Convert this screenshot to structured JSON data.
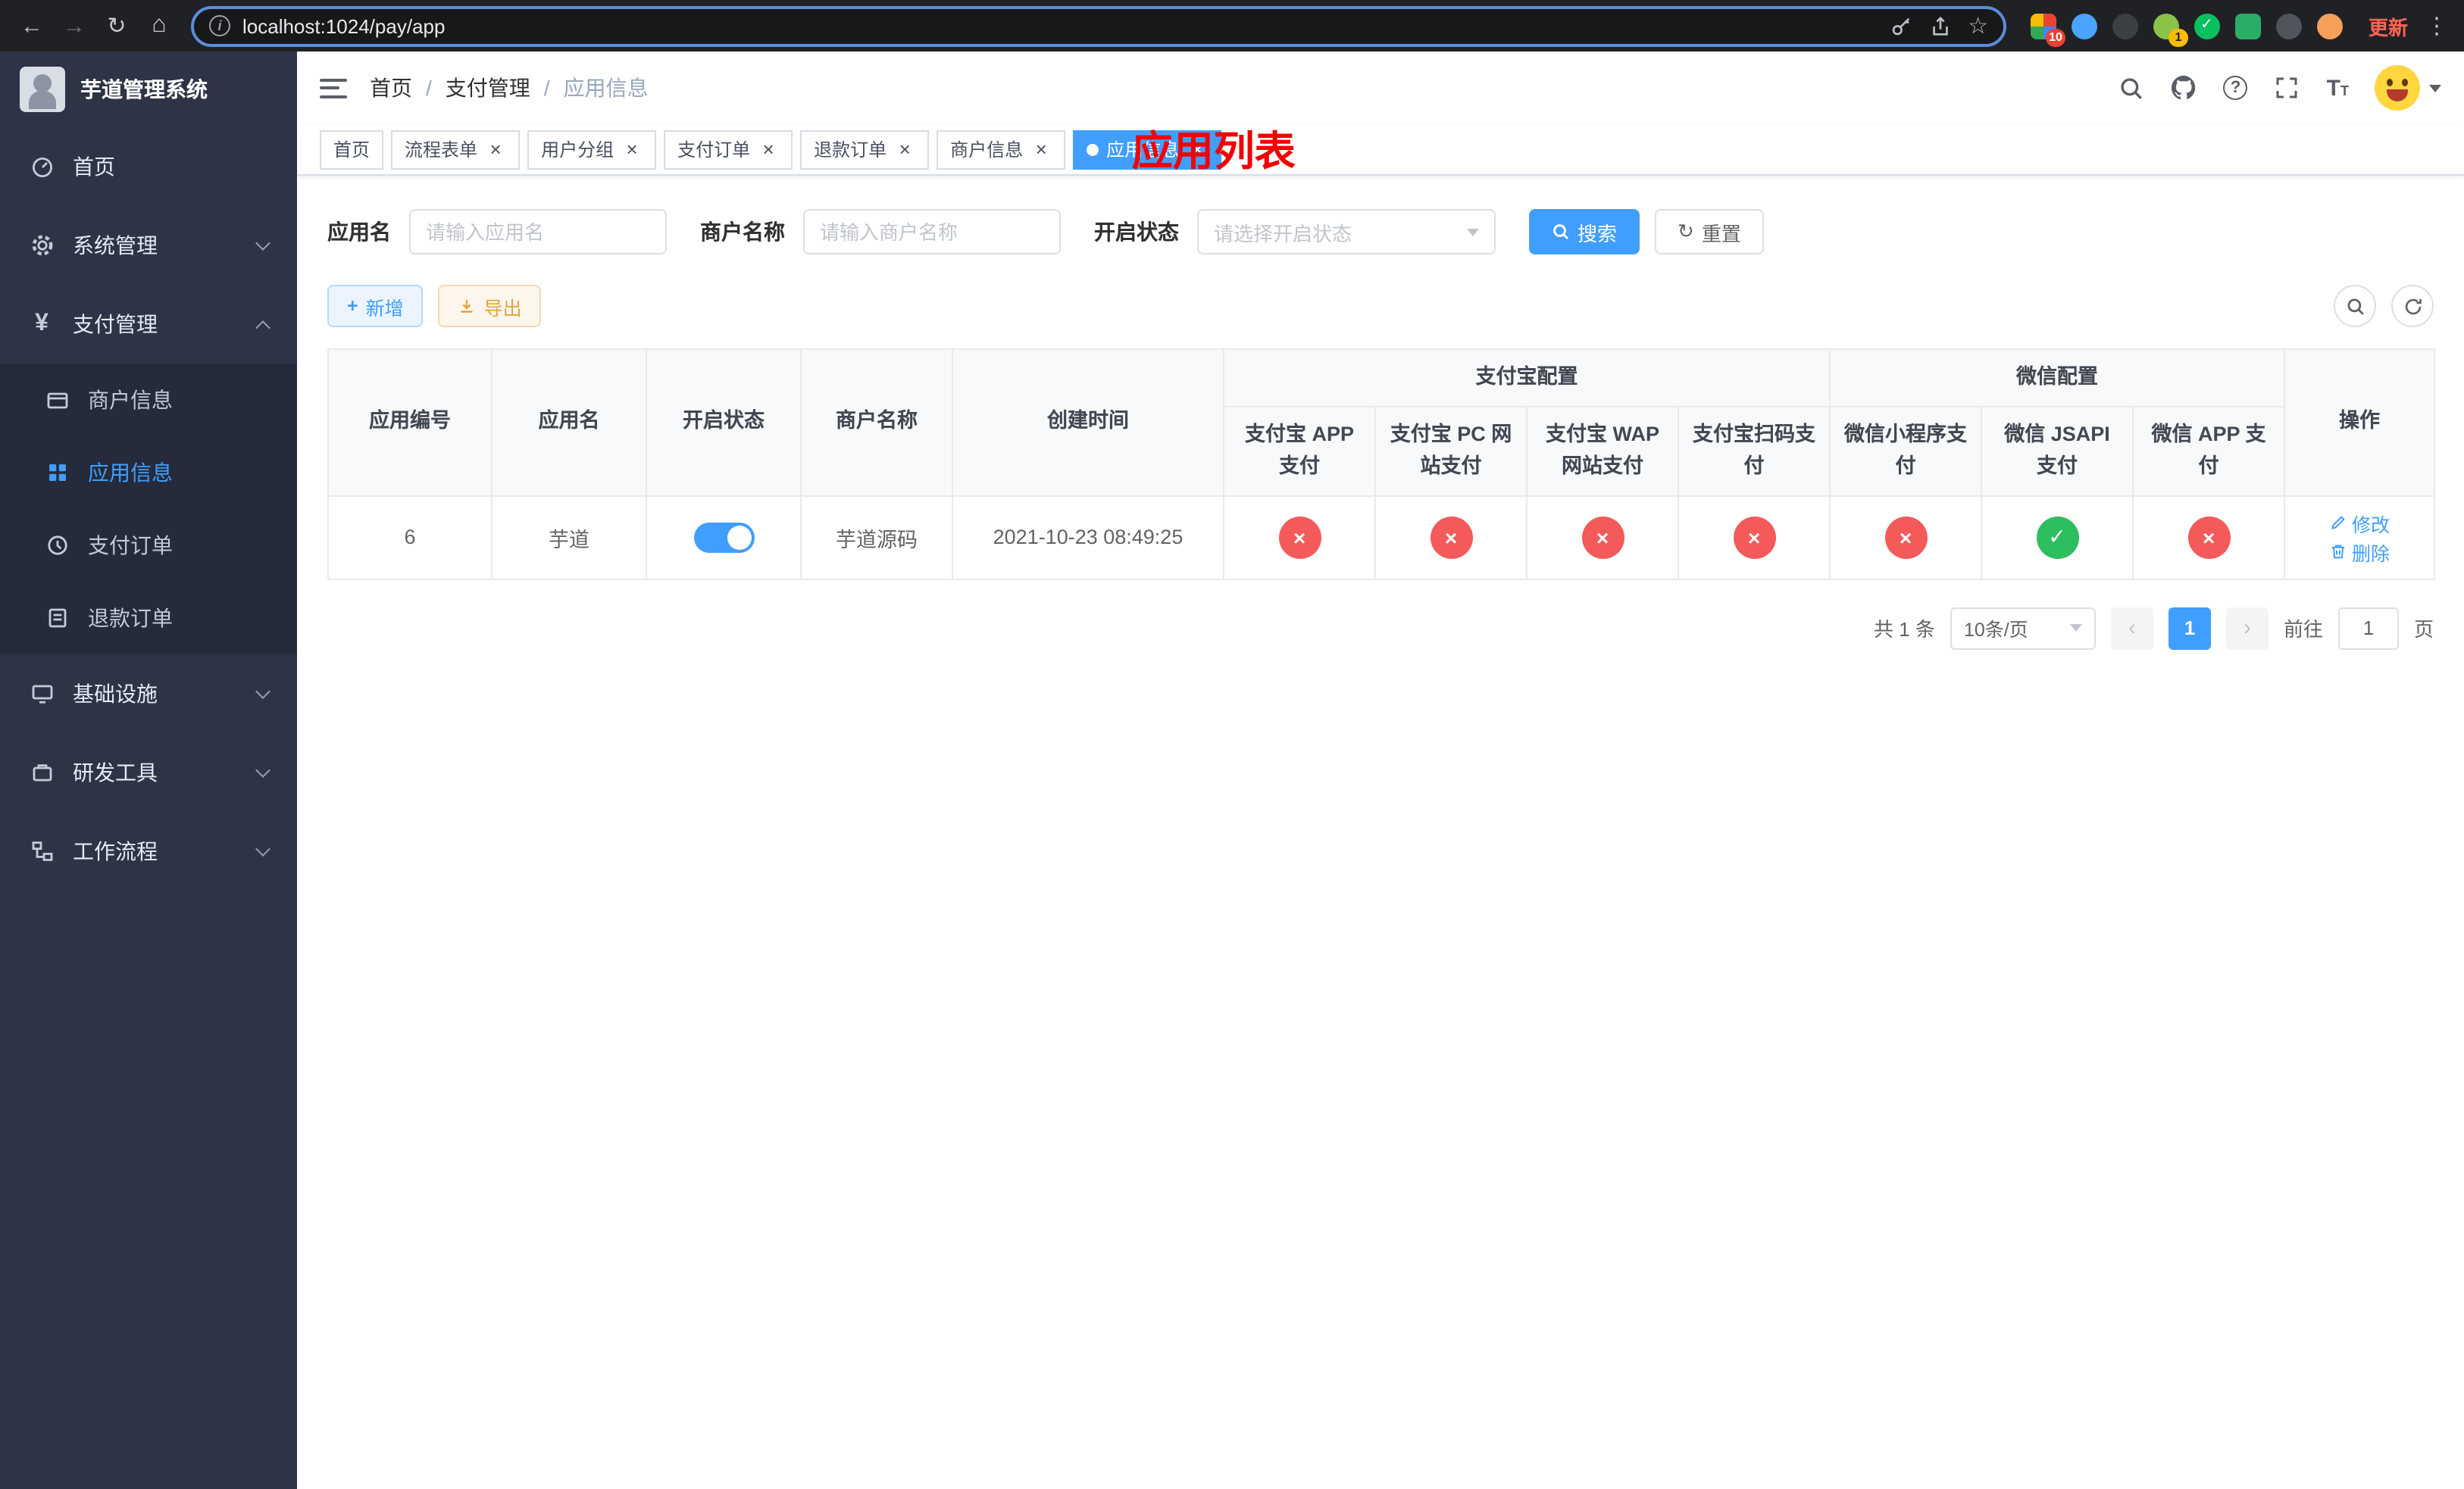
{
  "browser": {
    "url": "localhost:1024/pay/app",
    "update_label": "更新",
    "ext_badge_1": "10",
    "ext_badge_2": "1"
  },
  "sidebar": {
    "title": "芋道管理系统",
    "menu": [
      {
        "label": "首页"
      },
      {
        "label": "系统管理"
      },
      {
        "label": "支付管理",
        "children": [
          {
            "label": "商户信息"
          },
          {
            "label": "应用信息"
          },
          {
            "label": "支付订单"
          },
          {
            "label": "退款订单"
          }
        ]
      },
      {
        "label": "基础设施"
      },
      {
        "label": "研发工具"
      },
      {
        "label": "工作流程"
      }
    ]
  },
  "header": {
    "breadcrumb": [
      {
        "label": "首页"
      },
      {
        "label": "支付管理"
      },
      {
        "label": "应用信息"
      }
    ],
    "page_title": "应用列表"
  },
  "tabs": [
    {
      "label": "首页",
      "active": "false"
    },
    {
      "label": "流程表单",
      "active": "false"
    },
    {
      "label": "用户分组",
      "active": "false"
    },
    {
      "label": "支付订单",
      "active": "false"
    },
    {
      "label": "退款订单",
      "active": "false"
    },
    {
      "label": "商户信息",
      "active": "false"
    },
    {
      "label": "应用信息",
      "active": "true"
    }
  ],
  "filters": {
    "app_name_label": "应用名",
    "app_name_placeholder": "请输入应用名",
    "merchant_label": "商户名称",
    "merchant_placeholder": "请输入商户名称",
    "status_label": "开启状态",
    "status_placeholder": "请选择开启状态",
    "search_label": "搜索",
    "reset_label": "重置"
  },
  "toolbar": {
    "add_label": "新增",
    "export_label": "导出"
  },
  "table": {
    "columns": {
      "app_id": "应用编号",
      "app_name": "应用名",
      "status": "开启状态",
      "merchant": "商户名称",
      "created": "创建时间",
      "alipay_group": "支付宝配置",
      "wechat_group": "微信配置",
      "alipay_app": "支付宝 APP 支付",
      "alipay_pc": "支付宝 PC 网站支付",
      "alipay_wap": "支付宝 WAP 网站支付",
      "alipay_qr": "支付宝扫码支付",
      "wx_mini": "微信小程序支付",
      "wx_jsapi": "微信 JSAPI 支付",
      "wx_app": "微信 APP 支付",
      "actions": "操作"
    },
    "rows": [
      {
        "id": "6",
        "name": "芋道",
        "enabled": "true",
        "merchant": "芋道源码",
        "created": "2021-10-23 08:49:25",
        "channels": [
          {
            "status": "fail",
            "glyph": "×"
          },
          {
            "status": "fail",
            "glyph": "×"
          },
          {
            "status": "fail",
            "glyph": "×"
          },
          {
            "status": "fail",
            "glyph": "×"
          },
          {
            "status": "fail",
            "glyph": "×"
          },
          {
            "status": "success",
            "glyph": "✓"
          },
          {
            "status": "fail",
            "glyph": "×"
          }
        ],
        "edit_label": "修改",
        "delete_label": "删除"
      }
    ]
  },
  "pagination": {
    "total": "共 1 条",
    "page_size": "10条/页",
    "page": "1",
    "goto_label": "前往",
    "goto_value": "1",
    "goto_suffix": "页"
  }
}
